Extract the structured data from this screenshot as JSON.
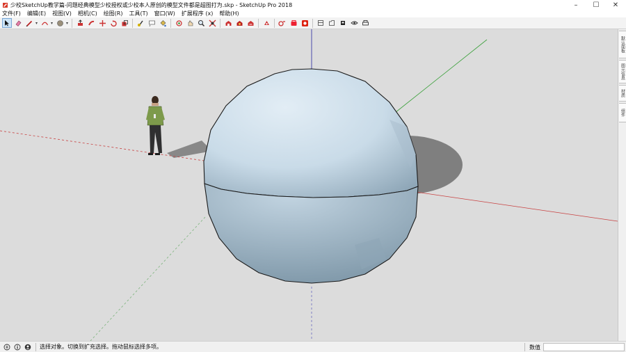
{
  "window": {
    "title": "少校SketchUp教学篇-问题经典模型少校授权或少校本人原创的模型文件都是超图打为.skp - SketchUp Pro 2018",
    "minimize_glyph": "–",
    "maximize_glyph": "☐",
    "close_glyph": "✕"
  },
  "menu": {
    "items": [
      {
        "label": "文件(F)"
      },
      {
        "label": "编辑(E)"
      },
      {
        "label": "视图(V)"
      },
      {
        "label": "相机(C)"
      },
      {
        "label": "绘图(R)"
      },
      {
        "label": "工具(T)"
      },
      {
        "label": "窗口(W)"
      },
      {
        "label": "扩展程序 (x)"
      },
      {
        "label": "帮助(H)"
      }
    ]
  },
  "tray": {
    "tabs": [
      {
        "label": "默认面板"
      },
      {
        "label": "图元信息"
      },
      {
        "label": "材质"
      },
      {
        "label": "组件"
      }
    ]
  },
  "status": {
    "message": "选择对象。切换到扩充选择。拖动鼠标选择多项。",
    "measurements_label": "数值",
    "measurements_value": ""
  },
  "colors": {
    "viewport_bg": "#dcdcdc",
    "sphere_fill": "#c8dbe8",
    "sphere_shadow": "#7f7f7f",
    "axis_red": "#c84040",
    "axis_green": "#3aa03a",
    "axis_blue": "#3a3aa8",
    "accent": "#0078d7"
  },
  "icons": {
    "app": "sketchup-logo-icon",
    "tools": [
      "select-icon",
      "eraser-icon",
      "pencil-icon",
      "arc-icon",
      "circle-icon",
      "push-pull-icon",
      "move-icon",
      "rotate-icon",
      "scale-icon",
      "offset-icon",
      "tape-measure-icon",
      "text-icon",
      "paint-bucket-icon",
      "orbit-icon",
      "pan-icon",
      "zoom-icon",
      "zoom-extents-icon",
      "warehouse-icon",
      "extension-warehouse-icon",
      "layout-icon",
      "ruby-icon",
      "display-icon"
    ]
  }
}
